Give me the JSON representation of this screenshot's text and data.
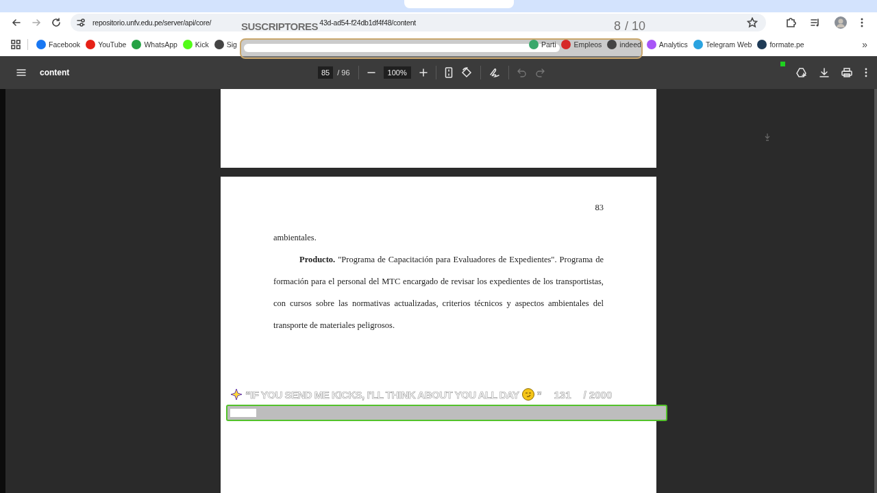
{
  "browser": {
    "url_parts": [
      "repositorio.unfv.edu.pe/server/api/core/",
      "43d-ad54-f24db1df4f48/content"
    ],
    "bookmarks_left": [
      {
        "label": "Facebook",
        "color": "#1877f2"
      },
      {
        "label": "YouTube",
        "color": "#e62117"
      },
      {
        "label": "WhatsApp",
        "color": "#25a244"
      },
      {
        "label": "Kick",
        "color": "#53fc18"
      },
      {
        "label": "Sig",
        "color": "#444444"
      }
    ],
    "bookmarks_right": [
      {
        "label": "Parti",
        "color": "#3aa86b"
      },
      {
        "label": "Empleos",
        "color": "#d62828"
      },
      {
        "label": "indeed",
        "color": "#444444"
      },
      {
        "label": "Analytics",
        "color": "#a855f7"
      },
      {
        "label": "Telegram Web",
        "color": "#2aa3e0"
      },
      {
        "label": "formate.pe",
        "color": "#1f3b57"
      }
    ],
    "more": "»"
  },
  "pdf_toolbar": {
    "title": "content",
    "page": "85",
    "total": "/ 96",
    "zoom": "100%",
    "undo": {
      "disabled": true
    },
    "redo": {
      "disabled": true
    }
  },
  "document": {
    "page_number": "83",
    "paragraphs": [
      {
        "text": "ambientales.",
        "indent": false
      },
      {
        "text": "**Producto.** \"Programa de Capacitación para Evaluadores de Expedientes\". Programa de formación para el personal del MTC encargado de revisar los expedientes de los transportistas, con cursos sobre las normativas actualizadas, criterios técnicos y aspectos ambientales del transporte de materiales peligrosos.",
        "indent": true
      }
    ]
  },
  "subscriber_goal": {
    "title": "SUSCRIPTORES",
    "count": "8",
    "target": "/ 10",
    "level": 0.8
  },
  "kicks_goal": {
    "message": "“IF YOU SEND ME KICKS, I'LL THINK ABOUT YOU ALL DAY",
    "message_end": "”",
    "count": "131",
    "target": "/ 2000",
    "level": 0.06
  }
}
